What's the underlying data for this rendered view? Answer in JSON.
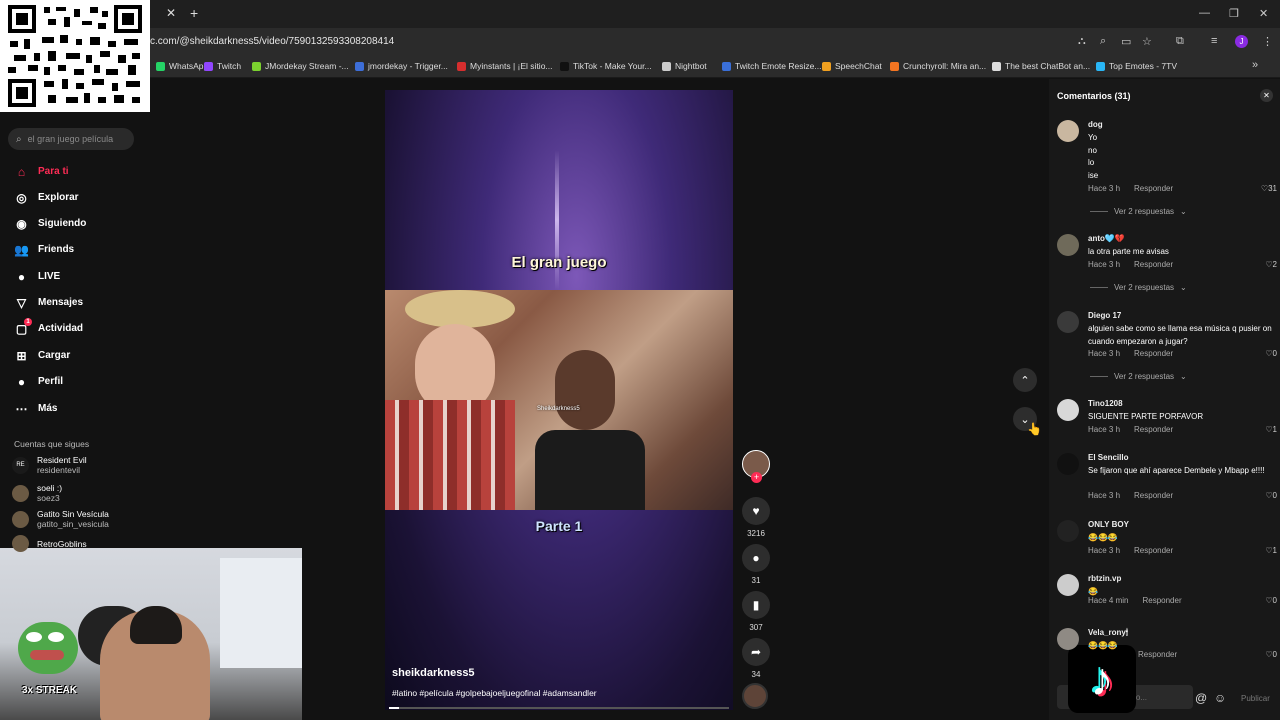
{
  "browser": {
    "new_tab": "+",
    "url": "c.com/@sheikdarkness5/video/7590132593308208414",
    "bookmarks": [
      {
        "label": "WhatsApp",
        "color": "#25d366"
      },
      {
        "label": "Twitch",
        "color": "#9146ff"
      },
      {
        "label": "JMordekay Stream -...",
        "color": "#7bd12f"
      },
      {
        "label": "jmordekay - Trigger...",
        "color": "#3d6ed8"
      },
      {
        "label": "Myinstants | ¡El sitio...",
        "color": "#d62e2e"
      },
      {
        "label": "TikTok - Make Your...",
        "color": "#111111"
      },
      {
        "label": "Nightbot",
        "color": "#cccccc"
      },
      {
        "label": "Twitch Emote Resize...",
        "color": "#3a6fd8"
      },
      {
        "label": "SpeechChat",
        "color": "#f0a020"
      },
      {
        "label": "Crunchyroll: Mira an...",
        "color": "#f47521"
      },
      {
        "label": "The best ChatBot an...",
        "color": "#dddddd"
      },
      {
        "label": "Top Emotes - 7TV",
        "color": "#29b6f6"
      }
    ]
  },
  "sidebar": {
    "search_placeholder": "el gran juego película",
    "nav": [
      {
        "label": "Para ti",
        "icon": "home-icon"
      },
      {
        "label": "Explorar",
        "icon": "compass-icon"
      },
      {
        "label": "Siguiendo",
        "icon": "following-icon"
      },
      {
        "label": "Friends",
        "icon": "friends-icon"
      },
      {
        "label": "LIVE",
        "icon": "live-icon"
      },
      {
        "label": "Mensajes",
        "icon": "messages-icon"
      },
      {
        "label": "Actividad",
        "icon": "activity-icon",
        "badge": "1"
      },
      {
        "label": "Cargar",
        "icon": "upload-icon"
      },
      {
        "label": "Perfil",
        "icon": "profile-icon"
      },
      {
        "label": "Más",
        "icon": "more-icon"
      }
    ],
    "following_heading": "Cuentas que sigues",
    "accounts": [
      {
        "name": "Resident Evil",
        "user": "residentevil",
        "avatar_text": "RE"
      },
      {
        "name": "soeli :)",
        "user": "soez3",
        "avatar_text": ""
      },
      {
        "name": "Gatito Sin Vesícula",
        "user": "gatito_sin_vesicula",
        "avatar_text": ""
      },
      {
        "name": "RetroGoblins",
        "user": "",
        "avatar_text": ""
      }
    ]
  },
  "webcam": {
    "streak": "3x STREAK"
  },
  "video": {
    "title_top": "El gran juego",
    "title_bottom": "Parte 1",
    "watermark": "Sheikdarkness5",
    "author": "sheikdarkness5",
    "hashtags": "#latino #película #golpebajoeljuegofinal #adamsandler",
    "progress": 0.03,
    "likes": "3216",
    "comments": "31",
    "saves": "307",
    "shares": "34"
  },
  "comments": {
    "title": "Comentarios (31)",
    "reply_label": "Responder",
    "input_placeholder": "ario...",
    "publish": "Publicar",
    "items": [
      {
        "user": "dog",
        "text": "Yo\nno\nlo\nise",
        "time": "Hace 3 h",
        "likes": "31",
        "replies": "Ver 2 respuestas"
      },
      {
        "user": "anto🩵💔",
        "text": "la otra parte me avisas",
        "time": "Hace 3 h",
        "likes": "2",
        "replies": "Ver 2 respuestas"
      },
      {
        "user": "Diego 17",
        "text": "alguien sabe como se llama esa música q pusier on cuando empezaron a jugar?",
        "time": "Hace 3 h",
        "likes": "0",
        "replies": "Ver 2 respuestas"
      },
      {
        "user": "Tino1208",
        "text": "SIGUENTE PARTE PORFAVOR",
        "time": "Hace 3 h",
        "likes": "1",
        "replies": ""
      },
      {
        "user": "El Sencillo",
        "text": "Se fijaron que ahí aparece Dembele y Mbapp e!!!!",
        "time": "Hace 3 h",
        "likes": "0",
        "replies": ""
      },
      {
        "user": "ONLY BOY",
        "text": "😂😂😂",
        "time": "Hace 3 h",
        "likes": "1",
        "replies": ""
      },
      {
        "user": "rbtzin.vp",
        "text": "😂",
        "time": "Hace 4 min",
        "likes": "0",
        "replies": ""
      },
      {
        "user": "Vela_rony🕯",
        "text": "😂😂😂",
        "time": "",
        "likes": "0",
        "replies": ""
      }
    ]
  }
}
